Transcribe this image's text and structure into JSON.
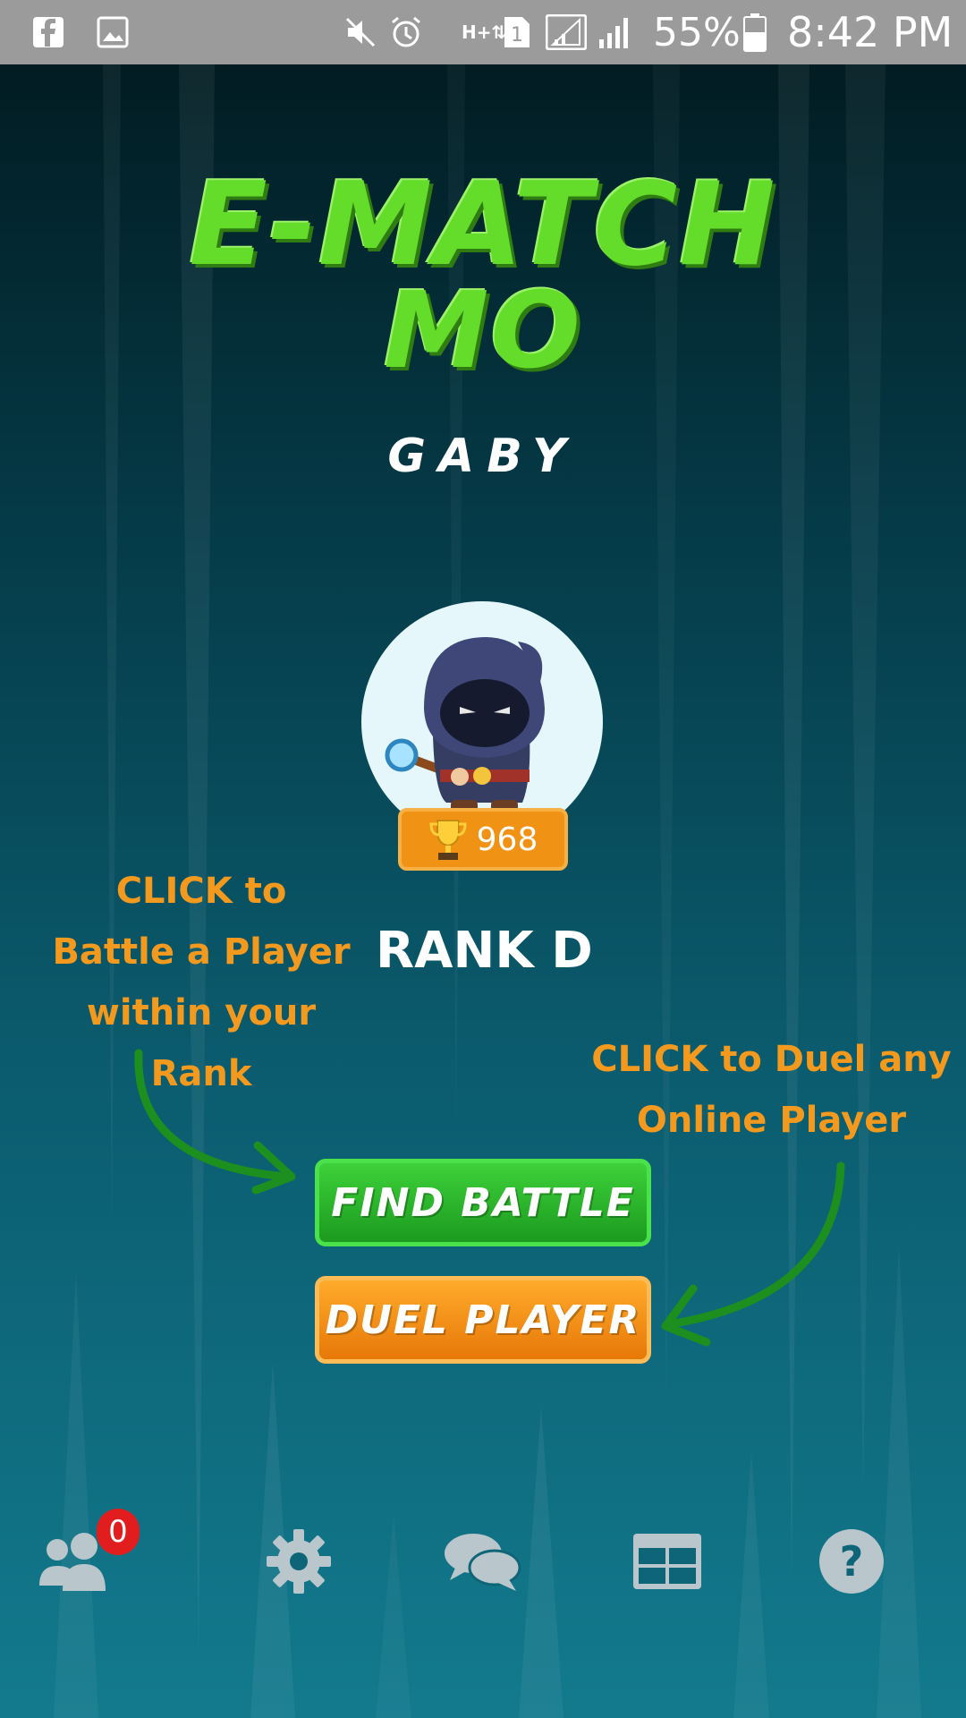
{
  "status_bar": {
    "battery_percent": "55%",
    "time": "8:42 PM",
    "left_icons": [
      "facebook-icon",
      "gallery-icon"
    ],
    "right_icons": [
      "mute-icon",
      "alarm-icon",
      "data-icon",
      "sim-icon",
      "signal-icon",
      "signal-icon-2",
      "battery-icon"
    ]
  },
  "game": {
    "title_line1": "E-MATCH",
    "title_line2": "MO",
    "player_name": "GABY",
    "trophies": "968",
    "rank": "RANK D"
  },
  "hints": {
    "left": [
      "CLICK to",
      "Battle a Player",
      "within your Rank"
    ],
    "right": [
      "CLICK to Duel any",
      "Online Player"
    ]
  },
  "buttons": {
    "find_battle": "FIND BATTLE",
    "duel_player": "DUEL PLAYER"
  },
  "bottom_nav": {
    "friends_badge": "0",
    "items": [
      "friends-icon",
      "settings-icon",
      "chat-icon",
      "leaderboard-icon",
      "help-icon"
    ]
  },
  "colors": {
    "title_green": "#64dc2a",
    "hint_orange": "#f39a1e",
    "find_battle_green": "#1b9a1f",
    "duel_orange": "#e77808",
    "badge_red": "#e11d1d"
  }
}
